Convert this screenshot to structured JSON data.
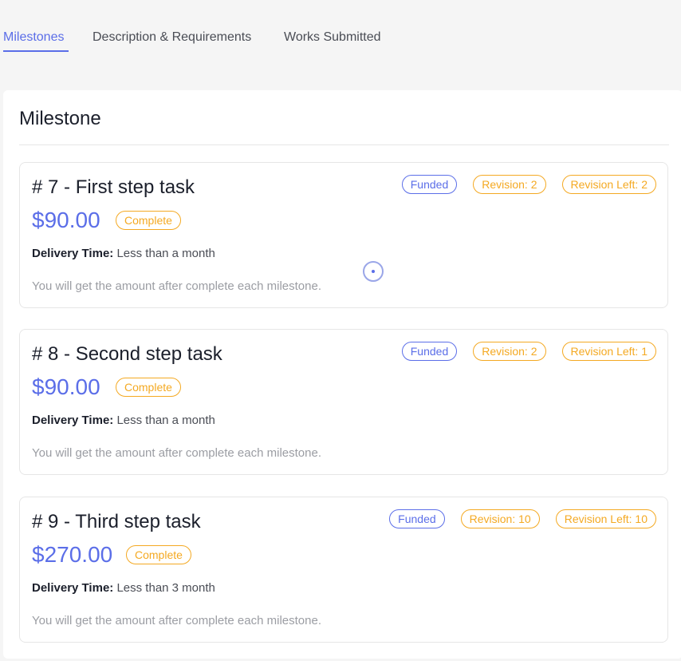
{
  "tabs": [
    {
      "label": "Milestones",
      "active": true
    },
    {
      "label": "Description & Requirements",
      "active": false
    },
    {
      "label": "Works Submitted",
      "active": false
    }
  ],
  "panel": {
    "title": "Milestone"
  },
  "milestones": [
    {
      "title": "# 7 - First step task",
      "price": "$90.00",
      "status": "Complete",
      "funded": "Funded",
      "revision": "Revision: 2",
      "revision_left": "Revision Left: 2",
      "delivery_label": "Delivery Time:",
      "delivery_value": "Less than a month",
      "note": "You will get the amount after complete each milestone."
    },
    {
      "title": "# 8 - Second step task",
      "price": "$90.00",
      "status": "Complete",
      "funded": "Funded",
      "revision": "Revision: 2",
      "revision_left": "Revision Left: 1",
      "delivery_label": "Delivery Time:",
      "delivery_value": "Less than a month",
      "note": "You will get the amount after complete each milestone."
    },
    {
      "title": "# 9 - Third step task",
      "price": "$270.00",
      "status": "Complete",
      "funded": "Funded",
      "revision": "Revision: 10",
      "revision_left": "Revision Left: 10",
      "delivery_label": "Delivery Time:",
      "delivery_value": "Less than 3 month",
      "note": "You will get the amount after complete each milestone."
    }
  ],
  "colors": {
    "accent": "#5b6ee8",
    "warning": "#f4a922",
    "background": "#f5f5f5",
    "card": "#ffffff"
  },
  "icons": {
    "loader": "loading-spinner-icon"
  }
}
